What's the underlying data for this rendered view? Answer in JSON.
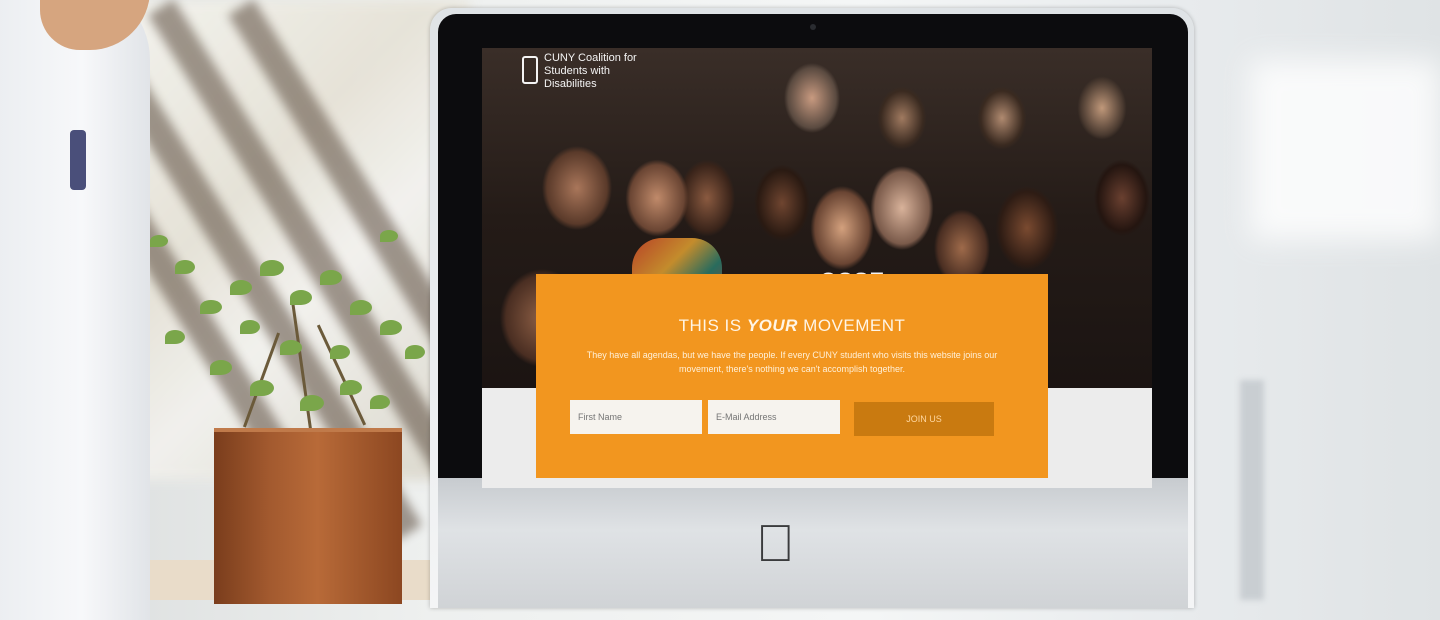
{
  "site": {
    "logo_text": "CUNY Coalition for Students with Disabilities",
    "hero_shirt_text": "CCSE"
  },
  "signup": {
    "title_prefix": "THIS IS ",
    "title_emphasis": "YOUR",
    "title_suffix": " MOVEMENT",
    "body": "They have all agendas, but we have the people. If every CUNY student who visits this website joins our movement, there's nothing we can't accomplish together.",
    "first_name_placeholder": "First Name",
    "email_placeholder": "E-Mail Address",
    "button_label": "JOIN US"
  },
  "colors": {
    "accent": "#f2961f",
    "button": "#c97a10"
  }
}
